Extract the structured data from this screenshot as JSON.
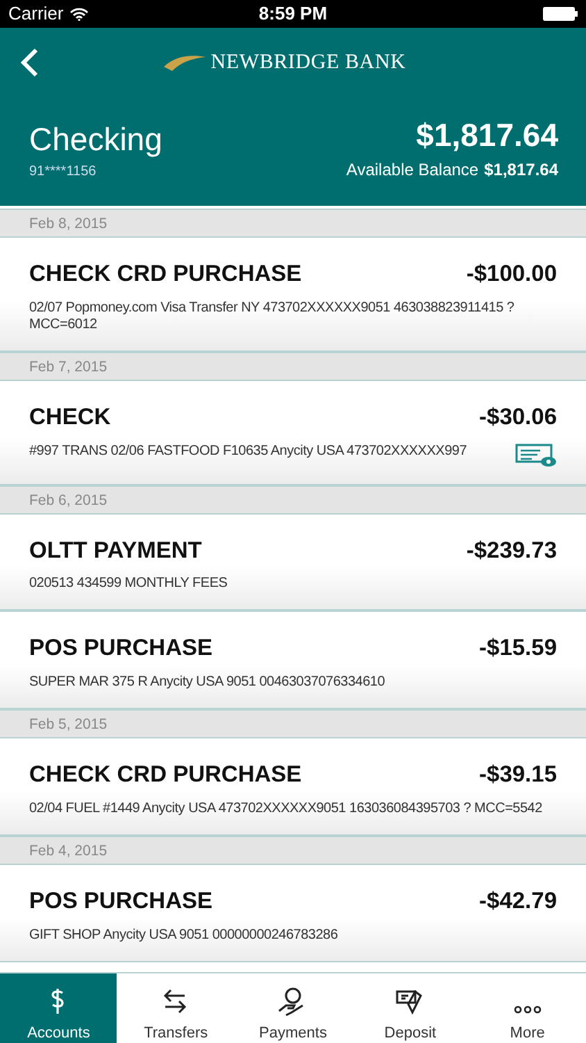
{
  "status_bar": {
    "carrier": "Carrier",
    "time": "8:59 PM"
  },
  "header": {
    "bank_name": "NEWBRIDGE BANK",
    "account_name": "Checking",
    "account_number": "91****1156",
    "balance": "$1,817.64",
    "available_label": "Available Balance",
    "available_amount": "$1,817.64"
  },
  "groups": [
    {
      "date": "Feb 8, 2015",
      "transactions": [
        {
          "title": "CHECK CRD PURCHASE",
          "amount": "-$100.00",
          "description": "02/07 Popmoney.com Visa Transfer NY 473702XXXXXX9051 463038823911415 ? MCC=6012",
          "check_image": false
        }
      ]
    },
    {
      "date": "Feb 7, 2015",
      "transactions": [
        {
          "title": "CHECK",
          "amount": "-$30.06",
          "description": "#997 TRANS 02/06 FASTFOOD F10635 Anycity USA 473702XXXXXX997",
          "check_image": true
        }
      ]
    },
    {
      "date": "Feb 6, 2015",
      "transactions": [
        {
          "title": "OLTT PAYMENT",
          "amount": "-$239.73",
          "description": "020513 434599 MONTHLY FEES",
          "check_image": false
        },
        {
          "title": "POS PURCHASE",
          "amount": "-$15.59",
          "description": "SUPER MAR 375 R Anycity USA 9051 00463037076334610",
          "check_image": false
        }
      ]
    },
    {
      "date": "Feb 5, 2015",
      "transactions": [
        {
          "title": "CHECK CRD PURCHASE",
          "amount": "-$39.15",
          "description": "02/04 FUEL #1449 Anycity USA 473702XXXXXX9051 163036084395703 ? MCC=5542",
          "check_image": false
        }
      ]
    },
    {
      "date": "Feb 4, 2015",
      "transactions": [
        {
          "title": "POS PURCHASE",
          "amount": "-$42.79",
          "description": "GIFT SHOP Anycity USA 9051 00000000246783286",
          "check_image": false
        }
      ]
    }
  ],
  "tab_bar": [
    {
      "label": "Accounts",
      "selected": true
    },
    {
      "label": "Transfers",
      "selected": false
    },
    {
      "label": "Payments",
      "selected": false
    },
    {
      "label": "Deposit",
      "selected": false
    },
    {
      "label": "More",
      "selected": false
    }
  ]
}
